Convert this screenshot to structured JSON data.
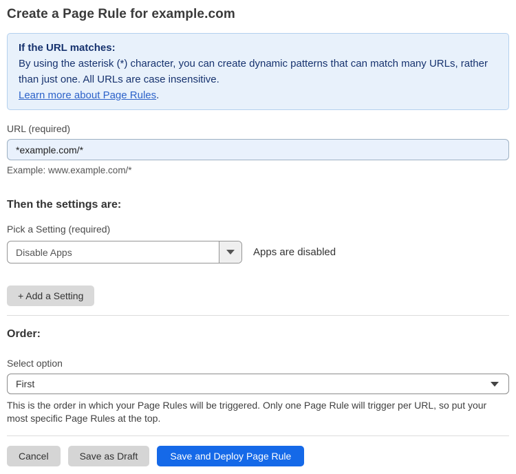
{
  "page": {
    "title": "Create a Page Rule for example.com"
  },
  "info_box": {
    "heading": "If the URL matches:",
    "body": "By using the asterisk (*) character, you can create dynamic patterns that can match many URLs, rather than just one. All URLs are case insensitive.",
    "link_label": "Learn more about Page Rules",
    "link_suffix": "."
  },
  "url_field": {
    "label": "URL (required)",
    "value": "*example.com/*",
    "helper": "Example: www.example.com/*"
  },
  "settings_section": {
    "heading": "Then the settings are:",
    "picker_label": "Pick a Setting (required)",
    "selected_setting": "Disable Apps",
    "status_text": "Apps are disabled",
    "add_setting_label": "+ Add a Setting"
  },
  "order_section": {
    "heading": "Order:",
    "select_label": "Select option",
    "selected_option": "First",
    "description": "This is the order in which your Page Rules will be triggered. Only one Page Rule will trigger per URL, so put your most specific Page Rules at the top."
  },
  "footer": {
    "cancel_label": "Cancel",
    "save_draft_label": "Save as Draft",
    "save_deploy_label": "Save and Deploy Page Rule"
  },
  "icons": {
    "dropdown_arrow": "chevron-down-icon"
  },
  "colors": {
    "primary_button": "#1569e8",
    "info_box_background": "#e8f1fb",
    "info_box_border": "#b3d0ee",
    "info_box_text": "#16326e",
    "link": "#2c62c9",
    "url_input_background": "#e9f1fc",
    "gray_button": "#d5d5d5"
  }
}
